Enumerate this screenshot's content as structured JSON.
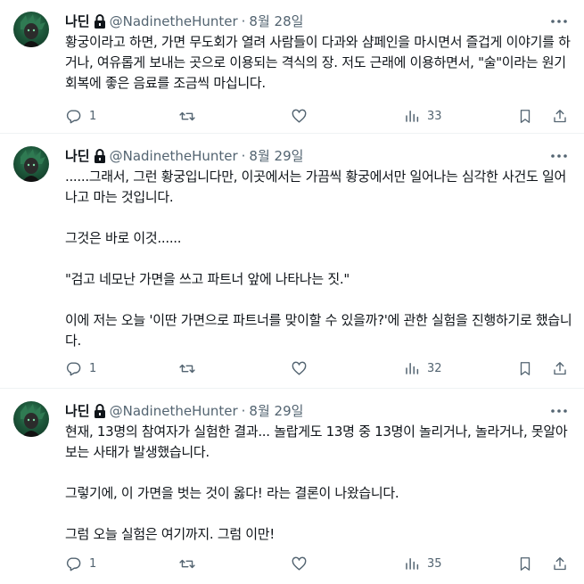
{
  "tweets": [
    {
      "author": "나딘",
      "handle": "@NadinetheHunter",
      "separator": "·",
      "date": "8월 28일",
      "text": "황궁이라고 하면, 가면 무도회가 열려 사람들이 다과와 샴페인을 마시면서 즐겁게 이야기를 하거나, 여유롭게 보내는 곳으로 이용되는 격식의 장. 저도 근래에 이용하면서, \"술\"이라는 원기회복에 좋은 음료를 조금씩 마십니다.",
      "reply_count": "1",
      "retweet_count": "",
      "like_count": "",
      "view_count": "33"
    },
    {
      "author": "나딘",
      "handle": "@NadinetheHunter",
      "separator": "·",
      "date": "8월 29일",
      "text": "......그래서, 그런 황궁입니다만, 이곳에서는 가끔씩 황궁에서만 일어나는 심각한 사건도 일어나고 마는 것입니다.\n\n그것은 바로 이것......\n\n\"검고 네모난 가면을 쓰고 파트너 앞에 나타나는 짓.\"\n\n이에 저는 오늘 '이딴 가면으로 파트너를 맞이할 수 있을까?'에 관한 실험을 진행하기로 했습니다.",
      "reply_count": "1",
      "retweet_count": "",
      "like_count": "",
      "view_count": "32"
    },
    {
      "author": "나딘",
      "handle": "@NadinetheHunter",
      "separator": "·",
      "date": "8월 29일",
      "text": "현재, 13명의 참여자가 실험한 결과... 놀랍게도 13명 중 13명이 놀리거나, 놀라거나, 못알아보는 사태가 발생했습니다.\n\n그렇기에, 이 가면을 벗는 것이 옳다! 라는 결론이 나왔습니다.\n\n그럼 오늘 실험은 여기까지. 그럼 이만!",
      "reply_count": "1",
      "retweet_count": "",
      "like_count": "",
      "view_count": "35"
    }
  ],
  "icons": [
    "avatar",
    "lock-icon",
    "more-icon",
    "reply-icon",
    "retweet-icon",
    "like-icon",
    "views-icon",
    "bookmark-icon",
    "share-icon"
  ],
  "colors": {
    "text": "#0f1419",
    "secondary": "#536471",
    "divider": "#eff3f4"
  }
}
